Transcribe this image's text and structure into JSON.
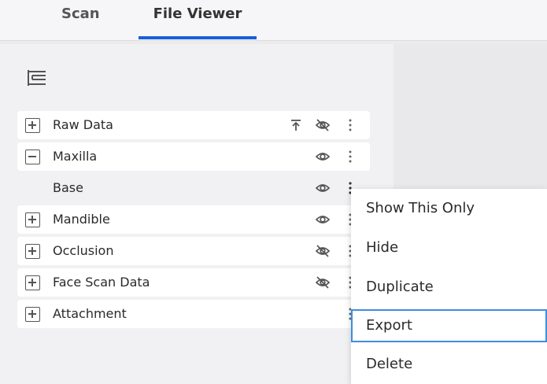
{
  "tabs": [
    {
      "label": "Scan"
    },
    {
      "label": "File Viewer",
      "active": true
    }
  ],
  "accent_color": "#1a5fd8",
  "tree": [
    {
      "label": "Raw Data",
      "expander": "plus",
      "icons": [
        "upload-icon",
        "eye-off-icon",
        "more-vertical-icon"
      ]
    },
    {
      "label": "Maxilla",
      "expander": "minus",
      "icons": [
        "eye-icon",
        "more-vertical-icon"
      ]
    },
    {
      "label": "Base",
      "expander": "none",
      "icons": [
        "eye-icon",
        "more-vertical-icon"
      ]
    },
    {
      "label": "Mandible",
      "expander": "plus",
      "icons": [
        "eye-icon",
        "more-vertical-icon"
      ]
    },
    {
      "label": "Occlusion",
      "expander": "plus",
      "icons": [
        "eye-off-icon",
        "more-vertical-icon"
      ]
    },
    {
      "label": "Face Scan Data",
      "expander": "plus",
      "icons": [
        "eye-off-icon",
        "more-vertical-icon"
      ]
    },
    {
      "label": "Attachment",
      "expander": "plus",
      "icons": [
        "more-vertical-icon"
      ]
    }
  ],
  "context_menu": {
    "items": [
      {
        "label": "Show This Only"
      },
      {
        "label": "Hide"
      },
      {
        "label": "Duplicate"
      },
      {
        "label": "Export",
        "selected": true
      },
      {
        "label": "Delete"
      }
    ]
  }
}
